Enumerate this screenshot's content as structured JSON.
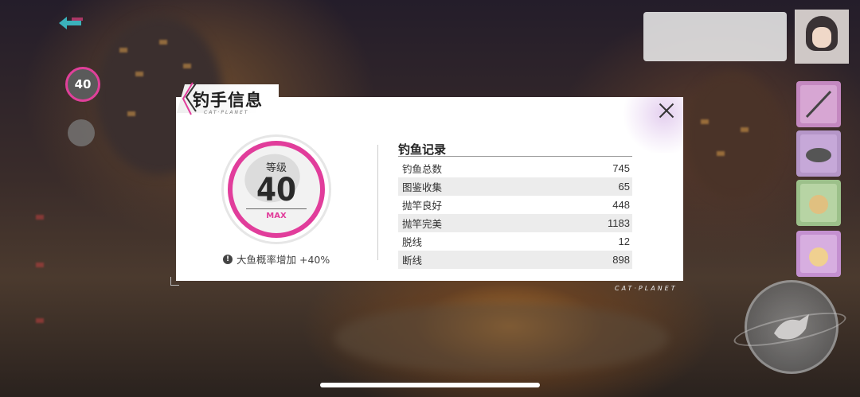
{
  "left_menu": {
    "level_value": "40"
  },
  "modal": {
    "title": "钓手信息",
    "subtitle": "CAT·PLANET",
    "level": {
      "label": "等级",
      "value": "40",
      "max_label": "MAX"
    },
    "bonus_text": "大鱼概率增加 +40%",
    "records": {
      "title": "钓鱼记录",
      "rows": [
        {
          "label": "钓鱼总数",
          "value": "745"
        },
        {
          "label": "图鉴收集",
          "value": "65"
        },
        {
          "label": "抛竿良好",
          "value": "448"
        },
        {
          "label": "抛竿完美",
          "value": "1183"
        },
        {
          "label": "脱线",
          "value": "12"
        },
        {
          "label": "断线",
          "value": "898"
        }
      ]
    }
  },
  "footer_brand": "CAT·PLANET",
  "colors": {
    "accent_pink": "#e13d9b",
    "panel_bg": "#ffffff",
    "row_alt_bg": "#ececec"
  },
  "icons": [
    "back-arrow-icon",
    "close-icon",
    "info-icon",
    "fish-icon",
    "cast-rod-icon",
    "fishing-rod-icon",
    "bait-icon",
    "food-icon",
    "cat-icon"
  ]
}
